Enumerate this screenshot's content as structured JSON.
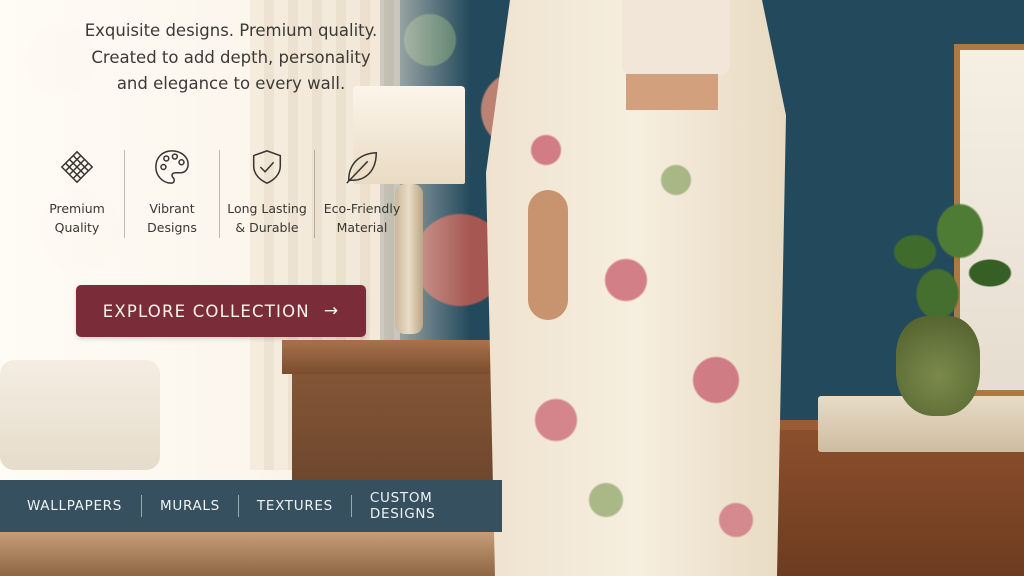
{
  "tagline": {
    "line1": "Exquisite designs. Premium quality.",
    "line2": "Created to add depth, personality",
    "line3": "and elegance to every wall."
  },
  "features": [
    {
      "icon": "premium-quality-icon",
      "label": "Premium\nQuality"
    },
    {
      "icon": "palette-icon",
      "label": "Vibrant\nDesigns"
    },
    {
      "icon": "shield-check-icon",
      "label": "Long Lasting\n& Durable"
    },
    {
      "icon": "leaf-icon",
      "label": "Eco-Friendly\nMaterial"
    }
  ],
  "cta": {
    "label": "EXPLORE COLLECTION",
    "arrow": "→"
  },
  "nav": {
    "items": [
      "WALLPAPERS",
      "MURALS",
      "TEXTURES",
      "CUSTOM DESIGNS"
    ]
  },
  "colors": {
    "cta_bg": "#7a2d38",
    "nav_bg": "#36505f",
    "text": "#3d3a36"
  }
}
